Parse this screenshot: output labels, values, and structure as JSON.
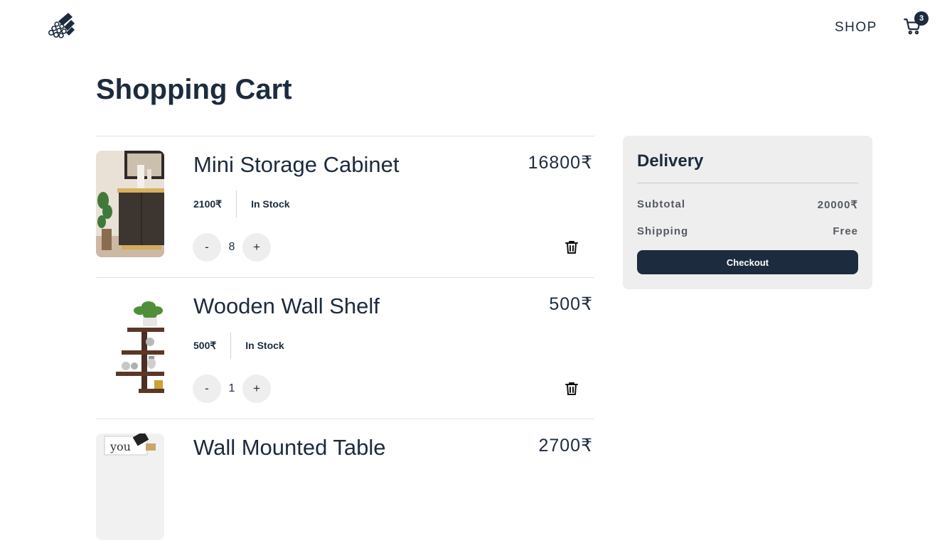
{
  "header": {
    "logo_icon": "wood-logs-logo",
    "nav_shop": "SHOP",
    "cart_count": "3",
    "cart_icon": "shopping-cart-icon"
  },
  "page_title": "Shopping Cart",
  "cart_items": [
    {
      "name": "Mini Storage Cabinet",
      "total": "16800₹",
      "unit_price": "2100₹",
      "stock": "In Stock",
      "quantity": "8",
      "minus_label": "-",
      "plus_label": "+"
    },
    {
      "name": "Wooden Wall Shelf",
      "total": "500₹",
      "unit_price": "500₹",
      "stock": "In Stock",
      "quantity": "1",
      "minus_label": "-",
      "plus_label": "+"
    },
    {
      "name": "Wall Mounted Table",
      "total": "2700₹"
    }
  ],
  "summary": {
    "title": "Delivery",
    "subtotal_label": "Subtotal",
    "subtotal_value": "20000₹",
    "shipping_label": "Shipping",
    "shipping_value": "Free",
    "checkout_label": "Checkout"
  },
  "colors": {
    "primary": "#1c2b3d",
    "panel_bg": "#eeeeee",
    "button_bg": "#eeeeee"
  }
}
